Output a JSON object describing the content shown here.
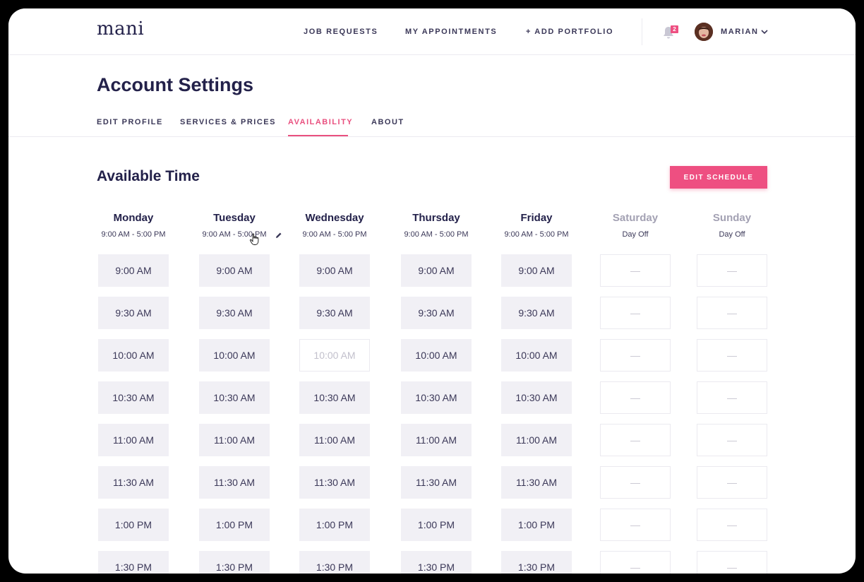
{
  "nav": {
    "logo": "mani",
    "links": [
      "JOB REQUESTS",
      "MY APPOINTMENTS",
      "+ ADD PORTFOLIO"
    ],
    "notification_count": "2",
    "user_name": "MARIAN"
  },
  "page": {
    "title": "Account Settings",
    "tabs": [
      "EDIT PROFILE",
      "SERVICES & PRICES",
      "AVAILABILITY",
      "ABOUT"
    ],
    "active_tab": "AVAILABILITY"
  },
  "schedule": {
    "title": "Available Time",
    "edit_button": "EDIT SCHEDULE",
    "off_placeholder": "—",
    "days": [
      {
        "name": "Monday",
        "hours": "9:00 AM - 5:00 PM",
        "off": false
      },
      {
        "name": "Tuesday",
        "hours": "9:00 AM - 5:00 PM",
        "off": false
      },
      {
        "name": "Wednesday",
        "hours": "9:00 AM - 5:00 PM",
        "off": false
      },
      {
        "name": "Thursday",
        "hours": "9:00 AM - 5:00 PM",
        "off": false
      },
      {
        "name": "Friday",
        "hours": "9:00 AM - 5:00 PM",
        "off": false
      },
      {
        "name": "Saturday",
        "hours": "Day Off",
        "off": true
      },
      {
        "name": "Sunday",
        "hours": "Day Off",
        "off": true
      }
    ],
    "slots": [
      "9:00 AM",
      "9:30 AM",
      "10:00 AM",
      "10:30 AM",
      "11:00 AM",
      "11:30 AM",
      "1:00 PM",
      "1:30 PM"
    ],
    "unavailable": [
      {
        "day": "Wednesday",
        "slot": "10:00 AM"
      }
    ]
  },
  "colors": {
    "accent": "#ee4f81",
    "text_dark": "#23214a",
    "slot_bg": "#f1f0f5"
  }
}
